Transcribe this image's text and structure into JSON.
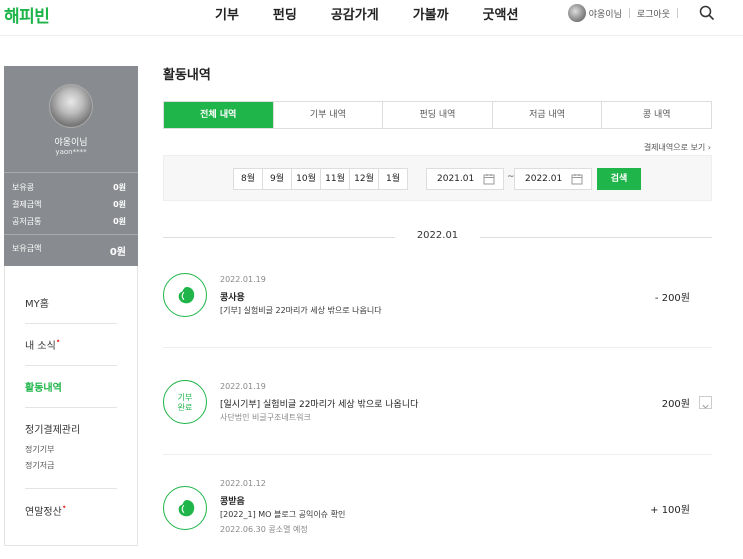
{
  "header": {
    "logo": "해피빈",
    "nav": [
      "기부",
      "펀딩",
      "공감가게",
      "가볼까",
      "굿액션"
    ],
    "user_name": "야옹이님",
    "logout": "로그아웃"
  },
  "profile": {
    "nickname": "야옹이님",
    "user_id": "yaon****",
    "stats": [
      {
        "label": "보유콩",
        "value": "0원"
      },
      {
        "label": "결제금액",
        "value": "0원"
      },
      {
        "label": "공저금통",
        "value": "0원"
      }
    ],
    "total": {
      "label": "보유금액",
      "value": "0원"
    }
  },
  "side_nav": {
    "my_home": "MY홈",
    "news": "내 소식",
    "activity": "활동내역",
    "regular": "정기결제관리",
    "regular_donation": "정기기부",
    "regular_saving": "정기저금",
    "year_end": "연말정산"
  },
  "main": {
    "title": "활동내역",
    "tabs": [
      "전체 내역",
      "기부 내역",
      "펀딩 내역",
      "저금 내역",
      "콩 내역"
    ],
    "receipt_link": "결제내역으로 보기",
    "months": [
      "8월",
      "9월",
      "10월",
      "11월",
      "12월",
      "1월"
    ],
    "date_from": "2021.01",
    "date_to": "2022.01",
    "tilde": "~",
    "search": "검색",
    "month_header": "2022.01"
  },
  "items": [
    {
      "date": "2022.01.19",
      "title": "콩사용",
      "desc": "[기부] 실험비글 22마리가 세상 밖으로 나옵니다",
      "sub": "",
      "amount": "- 200원",
      "icon": "bean-icon"
    },
    {
      "date": "2022.01.19",
      "title": "",
      "desc": "[일시기부] 실험비글 22마리가 세상 밖으로 나옵니다",
      "sub": "사단법인 비글구조네트워크",
      "amount": "200원",
      "badge_line1": "기부",
      "badge_line2": "완료",
      "icon": ""
    },
    {
      "date": "2022.01.12",
      "title": "콩받음",
      "desc": "[2022_1] MO 블로그 공익이슈 확인",
      "sub": "2022.06.30 콩소멸 예정",
      "amount": "+ 100원",
      "icon": "bean-icon"
    }
  ]
}
